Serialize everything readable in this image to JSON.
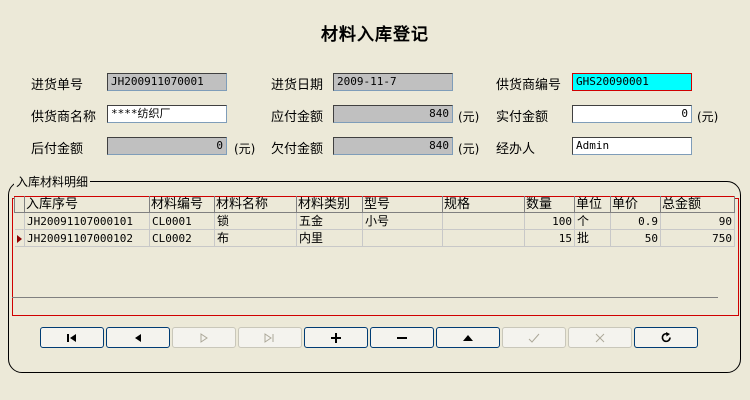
{
  "title": "材料入库登记",
  "form": {
    "purchase_no_label": "进货单号",
    "purchase_no": "JH200911070001",
    "purchase_date_label": "进货日期",
    "purchase_date": "2009-11-7",
    "supplier_code_label": "供货商编号",
    "supplier_code": "GHS20090001",
    "supplier_name_label": "供货商名称",
    "supplier_name": "****纺织厂",
    "payable_label": "应付金额",
    "payable": "840",
    "paid_label": "实付金额",
    "paid": "0",
    "later_pay_label": "后付金额",
    "later_pay": "0",
    "owed_label": "欠付金额",
    "owed": "840",
    "handler_label": "经办人",
    "handler": "Admin",
    "unit": "(元)"
  },
  "details": {
    "group_title": "入库材料明细",
    "columns": [
      "入库序号",
      "材料编号",
      "材料名称",
      "材料类别",
      "型号",
      "规格",
      "数量",
      "单位",
      "单价",
      "总金额"
    ],
    "rows": [
      [
        "JH20091107000101",
        "CL0001",
        "锁",
        "五金",
        "小号",
        "",
        "100",
        "个",
        "0.9",
        "90"
      ],
      [
        "JH20091107000102",
        "CL0002",
        "布",
        "内里",
        "",
        "",
        "15",
        "批",
        "50",
        "750"
      ]
    ]
  },
  "colors": {
    "highlight_field": "#00ffff",
    "frame_red": "#d00000"
  }
}
